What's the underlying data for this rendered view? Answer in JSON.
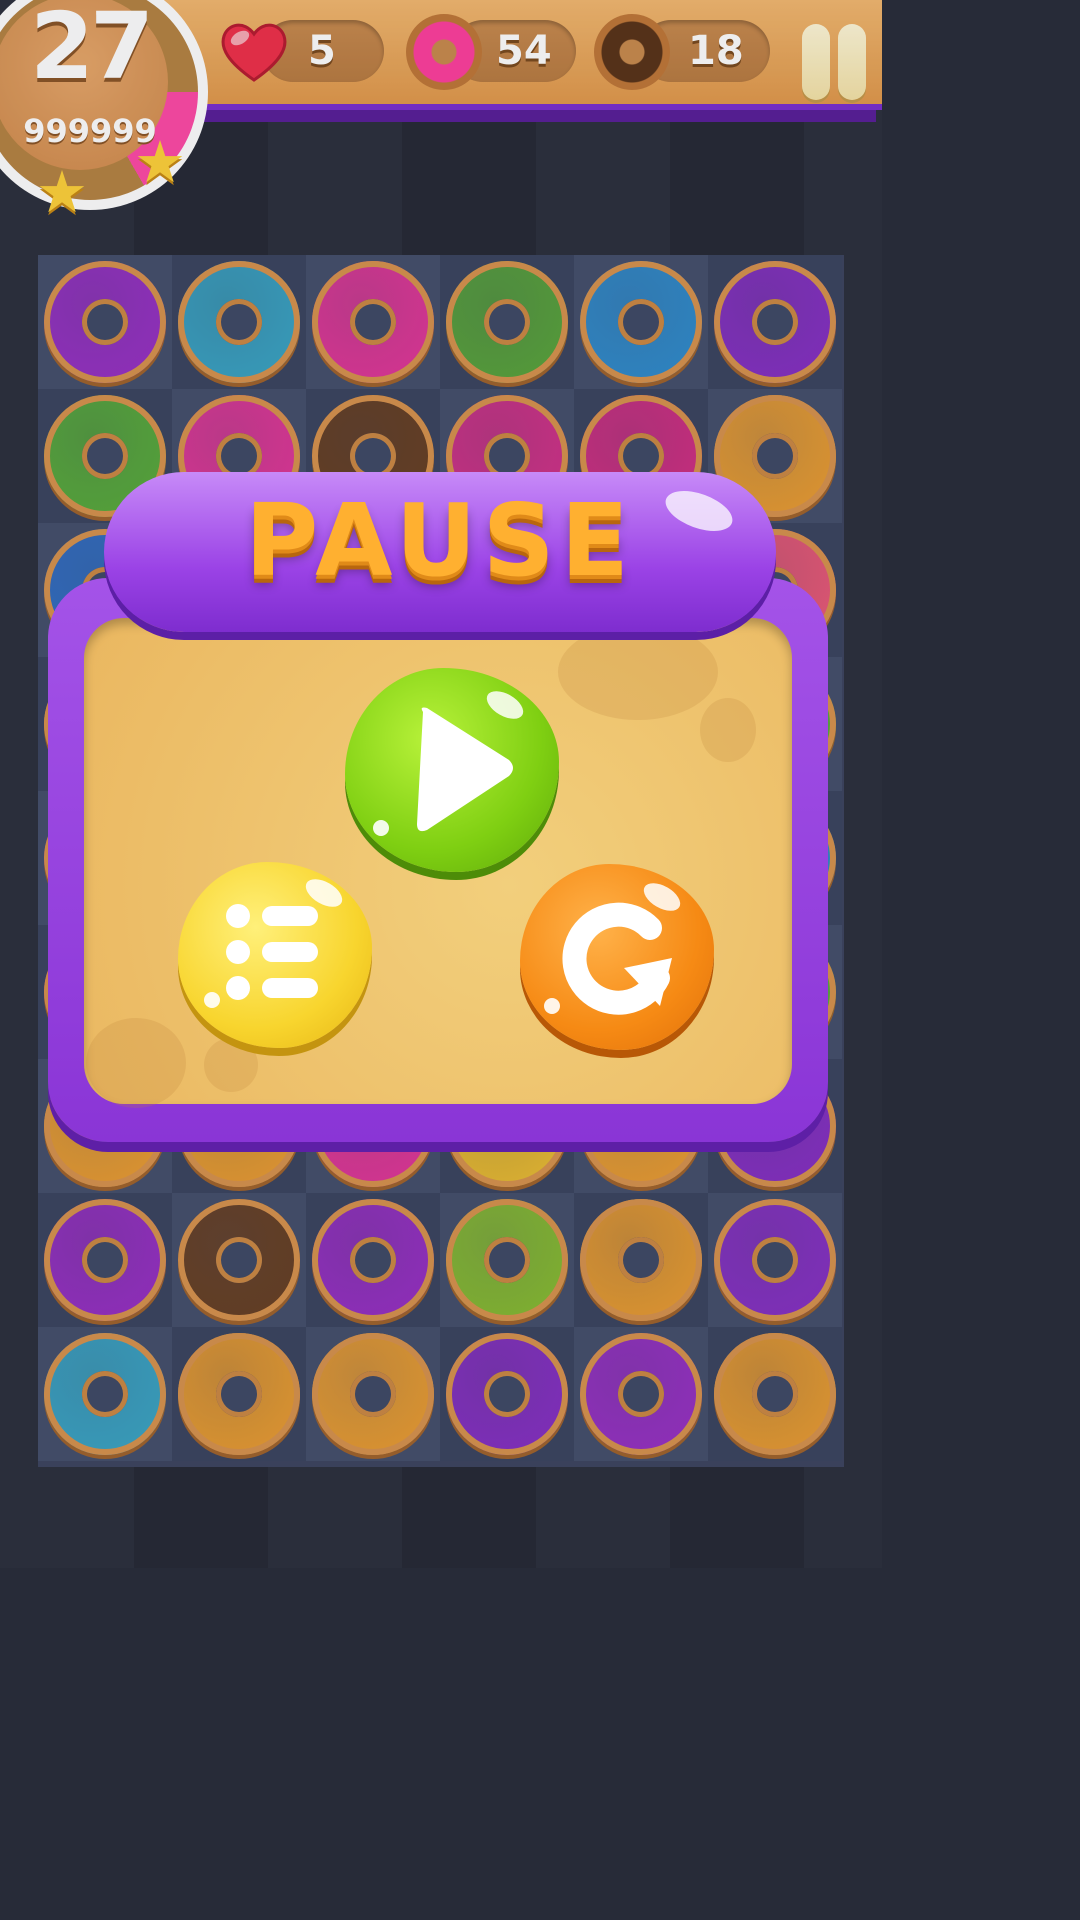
{
  "hud": {
    "level": "27",
    "score": "999999",
    "stars_earned": 2,
    "lives": "5",
    "pink_donuts": "54",
    "chocolate_donuts": "18"
  },
  "dialog": {
    "title": "PAUSE",
    "buttons": [
      "play",
      "menu",
      "restart"
    ]
  },
  "colors": {
    "dialog_frame": "#9b43e6",
    "dialog_body": "#f2cf7c",
    "title_text": "#ffb030",
    "play": "#7fcf12",
    "menu": "#f8d52e",
    "restart": "#f68a14"
  },
  "board": {
    "columns": 6,
    "rows": 9,
    "donuts": [
      [
        "#9b2fc8",
        "#3aa8c8",
        "#e8369a",
        "#5aa83a",
        "#2f8ed0",
        "#8a2fc8"
      ],
      [
        "#5ab03a",
        "#e8369a",
        "#6a4020",
        "#d8308a",
        "#d82e86",
        "#f0a030"
      ],
      [
        "#3070c8",
        "#8a2fc8",
        "#e8369a",
        "#9b2fc8",
        "#f0a030",
        "#f25a7a"
      ],
      [
        "#f0a030",
        "#5aa83a",
        "#d8308a",
        "#2f8ed0",
        "#8a2fc8",
        "#5ab03a"
      ],
      [
        "#9b2fc8",
        "#e8369a",
        "#3aa8c8",
        "#f0a030",
        "#5ab03a",
        "#2f8ed0"
      ],
      [
        "#e8369a",
        "#f0a030",
        "#9b2fc8",
        "#5ab03a",
        "#d8308a",
        "#5ab03a"
      ],
      [
        "#f0a030",
        "#f0a030",
        "#e8369a",
        "#f0c030",
        "#f0a030",
        "#8a2fc8"
      ],
      [
        "#9b2fc8",
        "#6a4020",
        "#9b2fc8",
        "#8ac030",
        "#f0a030",
        "#8a2fc8"
      ],
      [
        "#3aa8c8",
        "#f0a030",
        "#f0a030",
        "#8a2fc8",
        "#9b2fc8",
        "#f0a030"
      ]
    ]
  }
}
